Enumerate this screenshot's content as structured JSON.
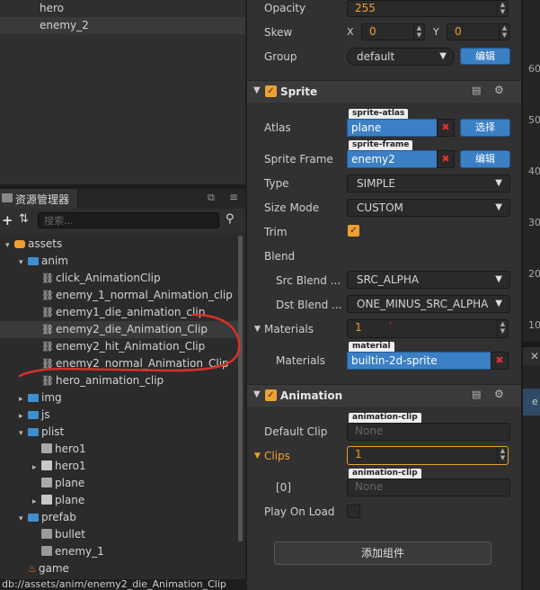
{
  "hierarchy": {
    "items": [
      "hero",
      "enemy_2"
    ]
  },
  "assets": {
    "tab_label": "资源管理器",
    "search_placeholder": "搜索...",
    "tree": [
      {
        "label": "assets",
        "depth": 0,
        "kind": "db",
        "arrow": "▾"
      },
      {
        "label": "anim",
        "depth": 1,
        "kind": "folder",
        "arrow": "▾"
      },
      {
        "label": "click_AnimationClip",
        "depth": 2,
        "kind": "clip",
        "arrow": ""
      },
      {
        "label": "enemy_1_normal_Animation_clip",
        "depth": 2,
        "kind": "clip",
        "arrow": ""
      },
      {
        "label": "enemy1_die_animation_clip",
        "depth": 2,
        "kind": "clip",
        "arrow": ""
      },
      {
        "label": "enemy2_die_Animation_Clip",
        "depth": 2,
        "kind": "clip",
        "arrow": "",
        "selected": true
      },
      {
        "label": "enemy2_hit_Animation_Clip",
        "depth": 2,
        "kind": "clip",
        "arrow": ""
      },
      {
        "label": "enemy2_normal_Animation_Clip",
        "depth": 2,
        "kind": "clip",
        "arrow": ""
      },
      {
        "label": "hero_animation_clip",
        "depth": 2,
        "kind": "clip",
        "arrow": ""
      },
      {
        "label": "img",
        "depth": 1,
        "kind": "folder",
        "arrow": "▸"
      },
      {
        "label": "js",
        "depth": 1,
        "kind": "folder",
        "arrow": "▸"
      },
      {
        "label": "plist",
        "depth": 1,
        "kind": "folder",
        "arrow": "▾"
      },
      {
        "label": "hero1",
        "depth": 2,
        "kind": "plist",
        "arrow": ""
      },
      {
        "label": "hero1",
        "depth": 2,
        "kind": "atlas",
        "arrow": "▸"
      },
      {
        "label": "plane",
        "depth": 2,
        "kind": "plist",
        "arrow": ""
      },
      {
        "label": "plane",
        "depth": 2,
        "kind": "atlas",
        "arrow": "▸"
      },
      {
        "label": "prefab",
        "depth": 1,
        "kind": "folder",
        "arrow": "▾"
      },
      {
        "label": "bullet",
        "depth": 2,
        "kind": "prefab",
        "arrow": ""
      },
      {
        "label": "enemy_1",
        "depth": 2,
        "kind": "prefab",
        "arrow": ""
      },
      {
        "label": "game",
        "depth": 1,
        "kind": "scene",
        "arrow": ""
      }
    ],
    "status_path": "db://assets/anim/enemy2_die_Animation_Clip"
  },
  "inspector": {
    "opacity": {
      "label": "Opacity",
      "value": "255"
    },
    "skew": {
      "label": "Skew",
      "x_label": "X",
      "x": "0",
      "y_label": "Y",
      "y": "0"
    },
    "group": {
      "label": "Group",
      "value": "default",
      "edit_btn": "编辑"
    },
    "sprite": {
      "title": "Sprite",
      "atlas": {
        "label": "Atlas",
        "tag": "sprite-atlas",
        "value": "plane",
        "btn": "选择"
      },
      "frame": {
        "label": "Sprite Frame",
        "tag": "sprite-frame",
        "value": "enemy2",
        "btn": "编辑"
      },
      "type": {
        "label": "Type",
        "value": "SIMPLE"
      },
      "size_mode": {
        "label": "Size Mode",
        "value": "CUSTOM"
      },
      "trim": {
        "label": "Trim"
      },
      "blend": {
        "label": "Blend"
      },
      "src_blend": {
        "label": "Src Blend ...",
        "value": "SRC_ALPHA"
      },
      "dst_blend": {
        "label": "Dst Blend ...",
        "value": "ONE_MINUS_SRC_ALPHA"
      },
      "materials": {
        "label": "Materials",
        "count": "1"
      },
      "material_item": {
        "label": "Materials",
        "tag": "material",
        "value": "builtin-2d-sprite"
      }
    },
    "animation": {
      "title": "Animation",
      "default_clip": {
        "label": "Default Clip",
        "tag": "animation-clip",
        "value": "None"
      },
      "clips": {
        "label": "Clips",
        "count": "1"
      },
      "clip0": {
        "label": "[0]",
        "tag": "animation-clip",
        "value": "None"
      },
      "play_on_load": {
        "label": "Play On Load"
      }
    },
    "add_component": "添加组件"
  },
  "right_ruler": [
    "60",
    "50",
    "40",
    "30",
    "20",
    "10"
  ],
  "colors": {
    "accent": "#3b7fc4",
    "orange": "#f0a030",
    "annotation": "#d9302a"
  }
}
